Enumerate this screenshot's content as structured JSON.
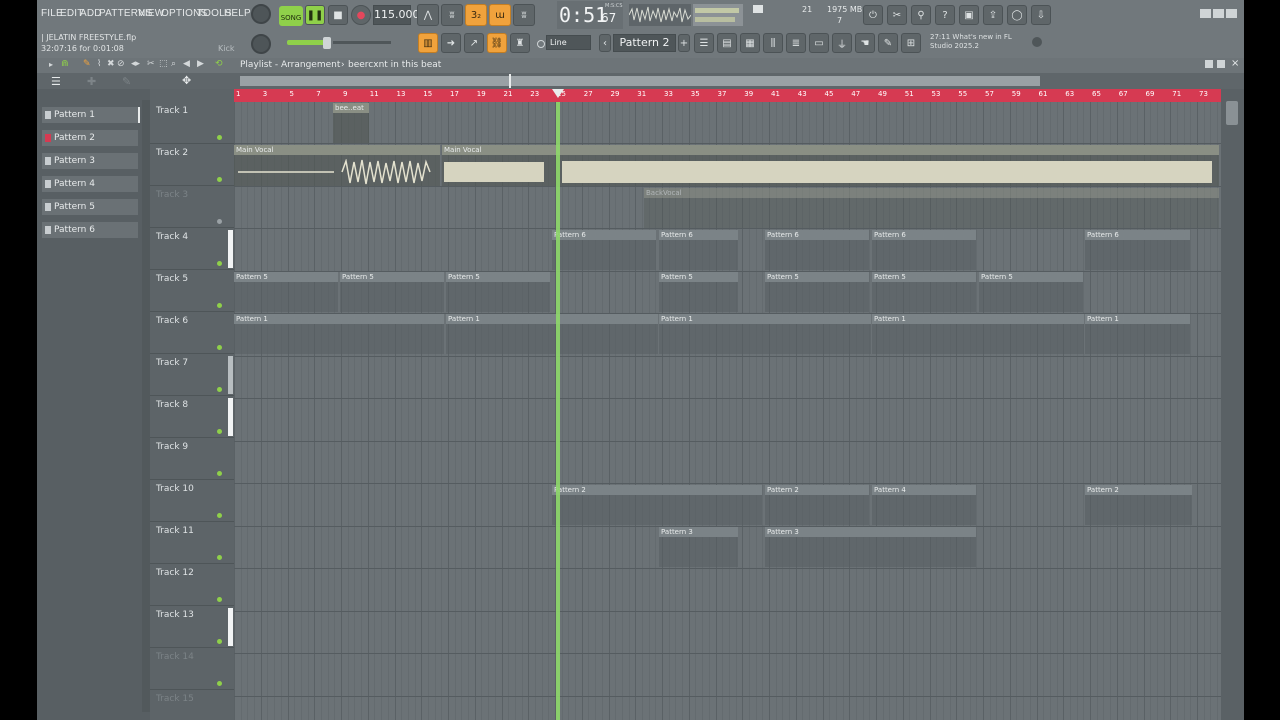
{
  "menu": [
    "FILE",
    "EDIT",
    "ADD",
    "PATTERNS",
    "VIEW",
    "OPTIONS",
    "TOOLS",
    "HELP"
  ],
  "project": {
    "file": "| JELATIN FREESTYLE.flp",
    "time": "32:07:16 for 0:01:08",
    "channel": "Kick"
  },
  "transport": {
    "mode": "SONG",
    "tempo": "115.000",
    "time_main": "0:51",
    "time_sub": "67",
    "time_label": "M:S:CS"
  },
  "stats": {
    "cpu": "21",
    "ram": "1975 MB",
    "poly": "7"
  },
  "snap": "Line",
  "pattern_selector": "Pattern 2",
  "news": {
    "time": "27:11",
    "text": "What's new in FL Studio 2025.2"
  },
  "breadcrumb": {
    "title": "Playlist - Arrangement",
    "sep": "›",
    "name": "beercxnt in this beat"
  },
  "patterns": [
    "Pattern 1",
    "Pattern 2",
    "Pattern 3",
    "Pattern 4",
    "Pattern 5",
    "Pattern 6"
  ],
  "tracks": [
    "Track 1",
    "Track 2",
    "Track 3",
    "Track 4",
    "Track 5",
    "Track 6",
    "Track 7",
    "Track 8",
    "Track 9",
    "Track 10",
    "Track 11",
    "Track 12",
    "Track 13",
    "Track 14",
    "Track 15"
  ],
  "ruler_ticks": [
    "1",
    "3",
    "5",
    "7",
    "9",
    "11",
    "13",
    "15",
    "17",
    "19",
    "21",
    "23",
    "25",
    "27",
    "29",
    "31",
    "33",
    "35",
    "37",
    "39",
    "41",
    "43",
    "45",
    "47",
    "49",
    "51",
    "53",
    "55",
    "57",
    "59",
    "61",
    "63",
    "65",
    "67",
    "69",
    "71",
    "73",
    "75"
  ],
  "clips": {
    "t1": "bee..eat",
    "t2a": "Main Vocal",
    "t2b": "Main Vocal",
    "t3": "BackVocal",
    "p6": "Pattern 6",
    "p5": "Pattern 5",
    "p1": "Pattern 1",
    "p2": "Pattern 2",
    "p4": "Pattern 4",
    "p3": "Pattern 3"
  },
  "colors": {
    "ruler": "#d63a52",
    "playhead": "#8ed86a",
    "accent": "#f0a23c",
    "led": "#8fd04a"
  }
}
